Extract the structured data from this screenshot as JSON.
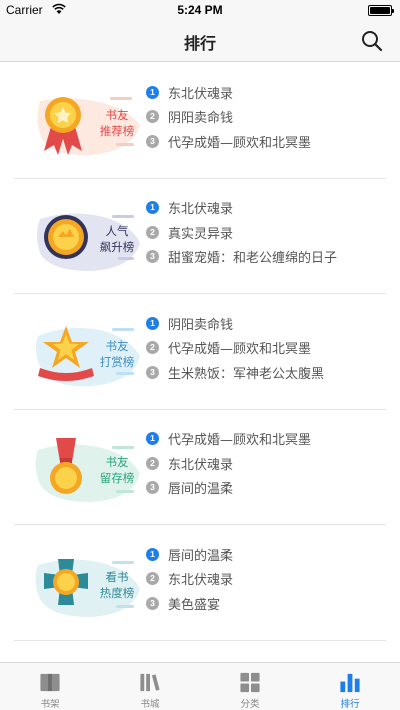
{
  "status_bar": {
    "carrier": "Carrier",
    "time": "5:24 PM"
  },
  "header": {
    "title": "排行"
  },
  "colors": {
    "accent": "#1f7fe8",
    "inactive": "#888888"
  },
  "rankings": [
    {
      "badge_line1": "书友",
      "badge_line2": "推荐榜",
      "badge_color": "#e24a4a",
      "books": [
        "东北伏魂录",
        "阴阳卖命钱",
        "代孕成婚—顾欢和北冥墨"
      ]
    },
    {
      "badge_line1": "人气",
      "badge_line2": "飙升榜",
      "badge_color": "#33335a",
      "books": [
        "东北伏魂录",
        "真实灵异录",
        "甜蜜宠婚：和老公缠绵的日子"
      ]
    },
    {
      "badge_line1": "书友",
      "badge_line2": "打赏榜",
      "badge_color": "#3d8fc6",
      "books": [
        "阴阳卖命钱",
        "代孕成婚—顾欢和北冥墨",
        "生米熟饭：军神老公太腹黑"
      ]
    },
    {
      "badge_line1": "书友",
      "badge_line2": "留存榜",
      "badge_color": "#2aa37e",
      "books": [
        "代孕成婚—顾欢和北冥墨",
        "东北伏魂录",
        "唇间的温柔"
      ]
    },
    {
      "badge_line1": "看书",
      "badge_line2": "热度榜",
      "badge_color": "#2d8a98",
      "books": [
        "唇间的温柔",
        "东北伏魂录",
        "美色盛宴"
      ]
    }
  ],
  "rank_numbers": [
    "1",
    "2",
    "3"
  ],
  "tabs": [
    {
      "label": "书架",
      "icon": "bookshelf-icon"
    },
    {
      "label": "书城",
      "icon": "bookstore-icon"
    },
    {
      "label": "分类",
      "icon": "category-icon"
    },
    {
      "label": "排行",
      "icon": "ranking-icon",
      "active": true
    }
  ]
}
